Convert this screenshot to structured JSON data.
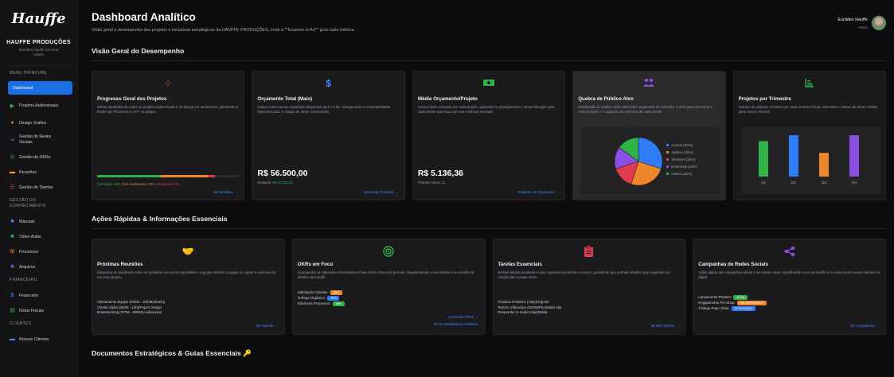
{
  "sidebar": {
    "logo": "Hauffe",
    "brand": "HAUFFE PRODUÇÕES",
    "user_line1": "Euclides Hauffe de Lima",
    "user_line2": "Admin",
    "section_menu": "MENU PRINCIPAL",
    "items_main": [
      {
        "label": "Dashboard",
        "icon": "dashboard-icon",
        "active": true
      },
      {
        "label": "Projetos Audiovisuais",
        "icon": "video-camera-icon",
        "color": "#2fb44a"
      },
      {
        "label": "Design Gráfico",
        "icon": "palette-icon",
        "color": "#f0862b"
      },
      {
        "label": "Gestão de Redes Sociais",
        "icon": "share-icon",
        "color": "#8a4fe0"
      },
      {
        "label": "Gestão de OKRs",
        "icon": "target-icon",
        "color": "#2fb44a"
      },
      {
        "label": "Reuniões",
        "icon": "handshake-icon",
        "color": "#f5a623"
      },
      {
        "label": "Gestão de Tarefas",
        "icon": "tasks-icon",
        "color": "#e04848"
      }
    ],
    "section_knowledge": "GESTÃO DO CONHECIMENTO",
    "items_knowledge": [
      {
        "label": "Manuais",
        "icon": "book-icon",
        "color": "#3b8bff"
      },
      {
        "label": "Vídeo Aulas",
        "icon": "video-icon",
        "color": "#2fb44a"
      },
      {
        "label": "Processos",
        "icon": "sitemap-icon",
        "color": "#f0862b"
      },
      {
        "label": "Arquivos",
        "icon": "folder-icon",
        "color": "#8a4fe0"
      }
    ],
    "section_finance": "FINANCEIRO",
    "items_finance": [
      {
        "label": "Financeiro",
        "icon": "dollar-icon",
        "color": "#3b8bff"
      },
      {
        "label": "Notas Fiscais",
        "icon": "invoice-icon",
        "color": "#2fb44a"
      }
    ],
    "section_clients": "CLIENTES",
    "items_clients": [
      {
        "label": "Nossos Clientes",
        "icon": "handshake-icon",
        "color": "#3b8bff"
      }
    ]
  },
  "header": {
    "title": "Dashboard Analítico",
    "subtitle": "Visão geral e desempenho dos projetos e iniciativas estratégicas da HAUFFE PRODUÇÕES, onde a **Essence is Art** guia cada métrica.",
    "user_name": "Euclides Hauffe",
    "user_role": "Admin"
  },
  "overview": {
    "title": "Visão Geral do Desempenho",
    "progress": {
      "title": "Progresso Geral dos Projetos",
      "desc": "Status atualizado de todos os projetos audiovisuais e de design em andamento, garantindo a fluidez da **Essence is Art** na prática.",
      "legend_done": "Concluído: 45%",
      "legend_progress": "Em Andamento: 33%",
      "legend_blocked": "Bloqueado: 5%",
      "done_pct": 45,
      "progress_pct": 33,
      "blocked_pct": 5,
      "link": "Ver Detalhes →"
    },
    "budget": {
      "title": "Orçamento Total (Maio)",
      "desc": "Gastos totais versus orçamento disponível para o mês, assegurando a sustentabilidade financeira para a criação de obras memoráveis.",
      "value": "R$ 56.500,00",
      "note_label": "Restante:",
      "note_value": "R$ 10.300,00",
      "link": "Gerenciar Finanças →"
    },
    "average": {
      "title": "Média Orçamento/Projeto",
      "desc": "Custo médio estimado por cada projeto, ajudando no planejamento e na precificação para cada cliente que busca ter sua essência revelada.",
      "value": "R$ 5.136,36",
      "note": "Projetos Ativos: 11",
      "link": "Detalhes do Orçamento →"
    },
    "audience": {
      "title": "Quebra de Público Alvo",
      "desc": "Distribuição do público entre diferentes segmentos do mercado, crucial para direcionar a comunicação e a captação da essência de cada cliente.",
      "legend": [
        {
          "label": "Jovens (30%)",
          "value": 30,
          "color": "#2f7df6"
        },
        {
          "label": "Adultos (25%)",
          "value": 25,
          "color": "#f0862b"
        },
        {
          "label": "Sêniores (15%)",
          "value": 15,
          "color": "#e03c50"
        },
        {
          "label": "Empresas (15%)",
          "value": 15,
          "color": "#8a4fe0"
        },
        {
          "label": "Outros (15%)",
          "value": 15,
          "color": "#2fb44a"
        }
      ]
    },
    "quarterly": {
      "title": "Projetos por Trimestre",
      "desc": "Número de projetos iniciados por cada trimestre fiscal, indicando o volume de obras criadas para nossos clientes.",
      "categories": [
        "Q1",
        "Q2",
        "Q3",
        "Q4"
      ],
      "values": [
        6,
        7,
        4,
        7
      ],
      "colors": [
        "#2fb44a",
        "#2f7df6",
        "#f0862b",
        "#8a4fe0"
      ]
    }
  },
  "quick": {
    "title": "Ações Rápidas & Informações Essenciais",
    "meetings": {
      "title": "Próximas Reuniões",
      "desc": "Mantenha-se atualizado sobre os próximos encontros importantes, seja para alinhar a equipe ou captar a essência de um novo projeto.",
      "items": [
        "Alinhamento Equipe (03/06 - 10h)Marketing",
        "Cliente Alpha (05/06 - 14h)Projeto Design",
        "Brainstorming (07/06 - 09h30)Audiovisual"
      ],
      "link": "Ver Agenda →"
    },
    "okrs": {
      "title": "OKRs em Foco",
      "desc": "Acompanhe os Objetivos e Resultados-Chave mais críticos do período, impulsionando o crescimento e a excelência artística da Hauffe.",
      "items": [
        {
          "label": "Satisfação Clientes:",
          "pill": "85%",
          "color": "#f0862b"
        },
        {
          "label": "Tráfego Orgânico:",
          "pill": "40%",
          "color": "#2f7df6"
        },
        {
          "label": "Eficiência Processos:",
          "pill": "95%",
          "color": "#2fb44a"
        }
      ],
      "link1": "Gerenciar OKRs →",
      "link2": "Ver Dashboards Analíticos"
    },
    "tasks": {
      "title": "Tarefas Essenciais",
      "desc": "Minhas tarefas pendentes mais urgentes e próximas a vencer, garantindo que nenhum detalhe seja esquecido na criação das nossas obras.",
      "items": [
        "Finalizar Relatório (Hoje)Urgente",
        "Roteiro Videoclipe (D3/06)Prioridade Alta",
        "Responder E-mails (Hoje)Diária"
      ],
      "link": "Minhas Tarefas →"
    },
    "campaigns": {
      "title": "Campanhas de Redes Sociais",
      "desc": "Visão rápida das campanhas ativas e seu status atual, amplificando a voz da Hauffe e a essência de nossos clientes no digital.",
      "items": [
        {
          "label": "Lançamento Produto:",
          "pill": "ATIVA",
          "color": "#2fb44a"
        },
        {
          "label": "Engajamento Pet Shop:",
          "pill": "EM ANDAMENTO",
          "color": "#f0862b"
        },
        {
          "label": "Tráfego Pago Jóias:",
          "pill": "OTIMIZANDO",
          "color": "#2f7df6"
        }
      ],
      "link": "Ver Campanhas →"
    }
  },
  "docs": {
    "title": "Documentos Estratégicos & Guias Essenciais 🔑"
  }
}
